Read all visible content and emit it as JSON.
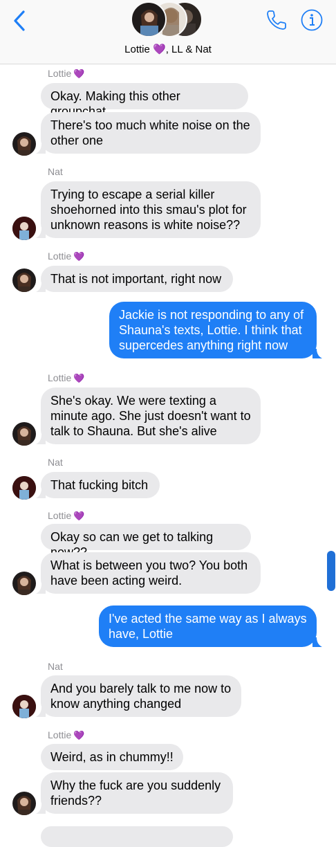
{
  "header": {
    "title": "Lottie 💜, LL & Nat",
    "back_icon": "chevron-left-icon",
    "call_icon": "phone-icon",
    "info_icon": "info-icon",
    "accent": "#1f7ff6"
  },
  "messages": [
    {
      "sender": "Lottie",
      "heart": "💜",
      "text": "Okay. Making this other groupchat"
    },
    {
      "text": "There's too much white noise on the other one"
    },
    {
      "sender": "Nat",
      "text": "Trying to escape a serial killer shoehorned into this smau's plot for unknown reasons is white noise??"
    },
    {
      "sender": "Lottie",
      "heart": "💜",
      "text": "That is not important, right now"
    },
    {
      "text": "Jackie is not responding to any of Shauna's texts, Lottie. I think that supercedes anything right now"
    },
    {
      "sender": "Lottie",
      "heart": "💜",
      "text": "She's okay. We were texting a minute ago. She just doesn't want to talk to Shauna. But she's alive"
    },
    {
      "sender": "Nat",
      "text": "That fucking bitch"
    },
    {
      "sender": "Lottie",
      "heart": "💜",
      "text": "Okay so can we get to talking now??"
    },
    {
      "text": "What is between you two? You both have been acting weird."
    },
    {
      "text": "I've acted the same way as I always have, Lottie"
    },
    {
      "sender": "Nat",
      "text": "And you barely talk to me now to know anything changed"
    },
    {
      "sender": "Lottie",
      "heart": "💜",
      "text": "Weird, as in chummy!!"
    },
    {
      "text": "Why the fuck are you suddenly friends??"
    }
  ]
}
